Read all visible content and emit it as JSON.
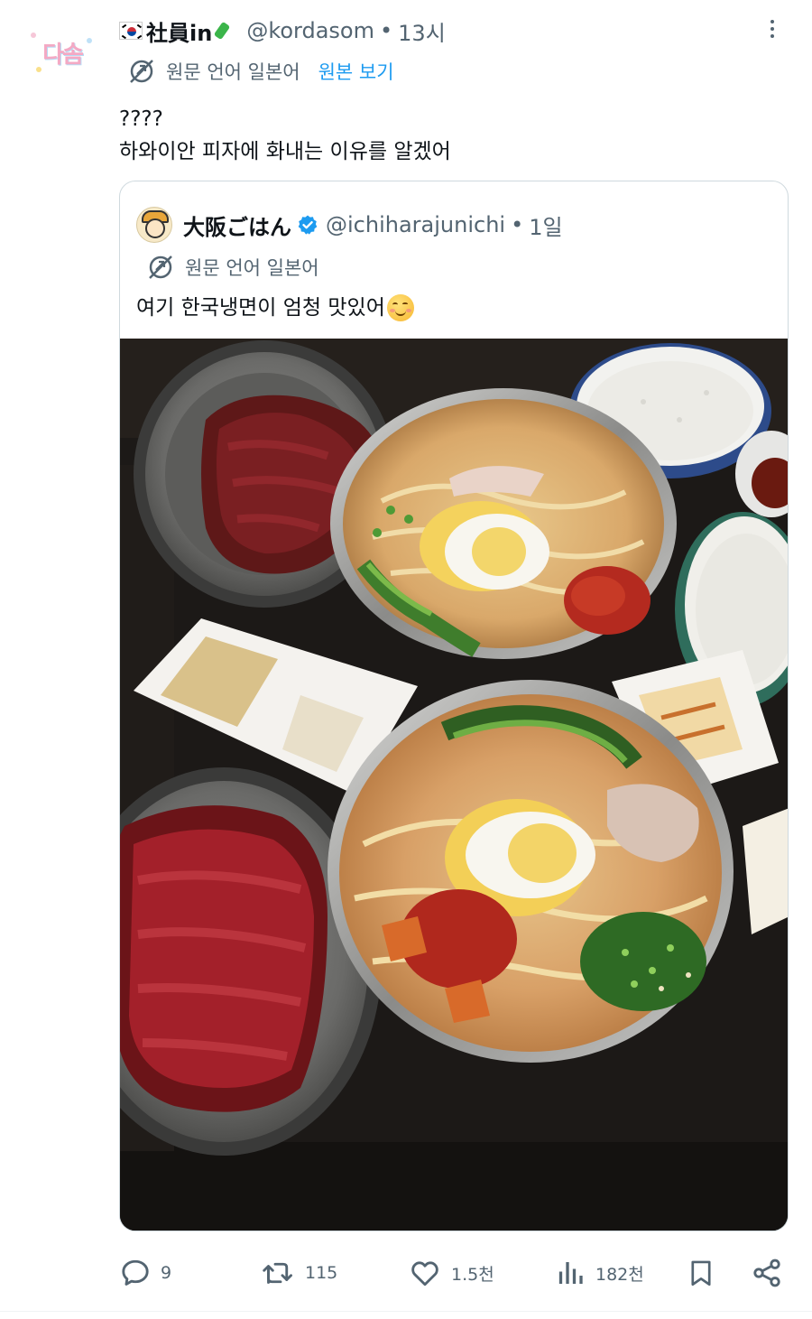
{
  "colors": {
    "text_primary": "#0f1419",
    "text_secondary": "#536471",
    "link": "#1d9bf0",
    "border": "#cfd9de",
    "verified_blue": "#1d9bf0"
  },
  "tweet": {
    "avatar_text": "다솜",
    "display_name": "社員in",
    "name_icons": [
      "korea-flag-icon",
      "japan-map-icon"
    ],
    "handle": "@kordasom",
    "separator": "•",
    "time": "13시",
    "translation_note": "원문 언어 일본어",
    "show_original": "원본 보기",
    "text_line_1": "????",
    "text_line_2": "하와이안 피자에 화내는 이유를 알겠어"
  },
  "quote": {
    "display_name": "大阪ごはん",
    "verified": true,
    "handle": "@ichiharajunichi",
    "separator": "•",
    "time": "1일",
    "translation_note": "원문 언어 일본어",
    "text": "여기 한국냉면이 엄청 맛있어",
    "text_emoji": "smiling-face-icon",
    "image_icon": "food-photo"
  },
  "actions": {
    "reply_count": "9",
    "retweet_count": "115",
    "like_count": "1.5천",
    "view_count": "182천",
    "icons": [
      "reply-icon",
      "retweet-icon",
      "like-icon",
      "views-icon",
      "bookmark-icon",
      "share-icon"
    ]
  }
}
